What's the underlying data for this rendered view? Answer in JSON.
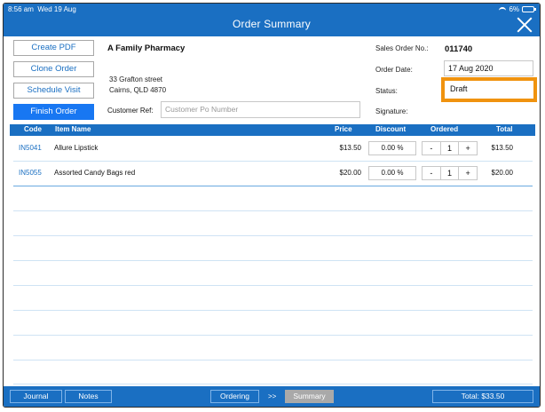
{
  "status_bar": {
    "time": "8:56 am",
    "date": "Wed 19 Aug",
    "battery": "6%"
  },
  "header": {
    "title": "Order Summary"
  },
  "actions": {
    "create_pdf": "Create PDF",
    "clone_order": "Clone Order",
    "schedule_visit": "Schedule Visit",
    "finish_order": "Finish Order"
  },
  "customer": {
    "name": "A Family Pharmacy",
    "address_line1": "33 Grafton street",
    "address_line2": "Cairns, QLD 4870",
    "ref_label": "Customer Ref:",
    "ref_placeholder": "Customer Po Number"
  },
  "order": {
    "number_label": "Sales Order No.:",
    "number": "011740",
    "date_label": "Order Date:",
    "date": "17 Aug 2020",
    "status_label": "Status:",
    "status": "Draft",
    "signature_label": "Signature:"
  },
  "table": {
    "headers": {
      "code": "Code",
      "item": "Item Name",
      "price": "Price",
      "discount": "Discount",
      "ordered": "Ordered",
      "total": "Total"
    },
    "rows": [
      {
        "code": "IN5041",
        "name": "Allure Lipstick",
        "price": "$13.50",
        "discount": "0.00 %",
        "minus": "-",
        "qty": "1",
        "plus": "+",
        "total": "$13.50"
      },
      {
        "code": "IN5055",
        "name": "Assorted Candy Bags red",
        "price": "$20.00",
        "discount": "0.00 %",
        "minus": "-",
        "qty": "1",
        "plus": "+",
        "total": "$20.00"
      }
    ]
  },
  "footer": {
    "journal": "Journal",
    "notes": "Notes",
    "ordering": "Ordering",
    "chevrons": ">>",
    "summary": "Summary",
    "total": "Total: $33.50"
  },
  "colors": {
    "primary": "#1a6fc2",
    "accent": "#1877f2",
    "highlight": "#f0930f"
  },
  "icons": {
    "close": "close-icon",
    "wifi": "wifi-icon",
    "battery": "battery-icon"
  }
}
